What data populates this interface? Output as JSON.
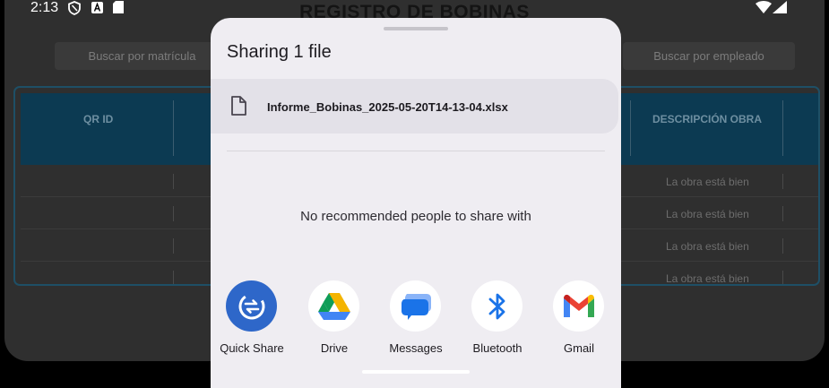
{
  "status_bar": {
    "time": "2:13",
    "icons": [
      "shield-icon",
      "a-icon",
      "sd-card-icon",
      "wifi-icon",
      "signal-icon"
    ]
  },
  "background_app": {
    "title": "REGISTRO DE BOBINAS",
    "search_left_placeholder": "Buscar por matrícula",
    "search_right_placeholder": "Buscar por empleado",
    "table": {
      "headers": [
        "QR ID",
        "DESCRIPCIÓN OBRA"
      ],
      "rows": [
        {
          "descripcion": ""
        },
        {
          "descripcion": "La obra está bien"
        },
        {
          "descripcion": "La obra está bien"
        },
        {
          "descripcion": "La obra está bien"
        },
        {
          "descripcion": "La obra está bien"
        }
      ]
    }
  },
  "share_sheet": {
    "title": "Sharing 1 file",
    "file_name": "Informe_Bobinas_2025-05-20T14-13-04.xlsx",
    "no_recommendations": "No recommended people to share with",
    "targets": [
      {
        "label": "Quick Share",
        "icon": "quick-share-icon"
      },
      {
        "label": "Drive",
        "icon": "drive-icon"
      },
      {
        "label": "Messages",
        "icon": "messages-icon"
      },
      {
        "label": "Bluetooth",
        "icon": "bluetooth-icon"
      },
      {
        "label": "Gmail",
        "icon": "gmail-icon"
      }
    ]
  },
  "colors": {
    "sheet_background": "#efedf2",
    "quick_share_blue": "#2e67c9",
    "table_header_dim": "#0c3a52"
  }
}
